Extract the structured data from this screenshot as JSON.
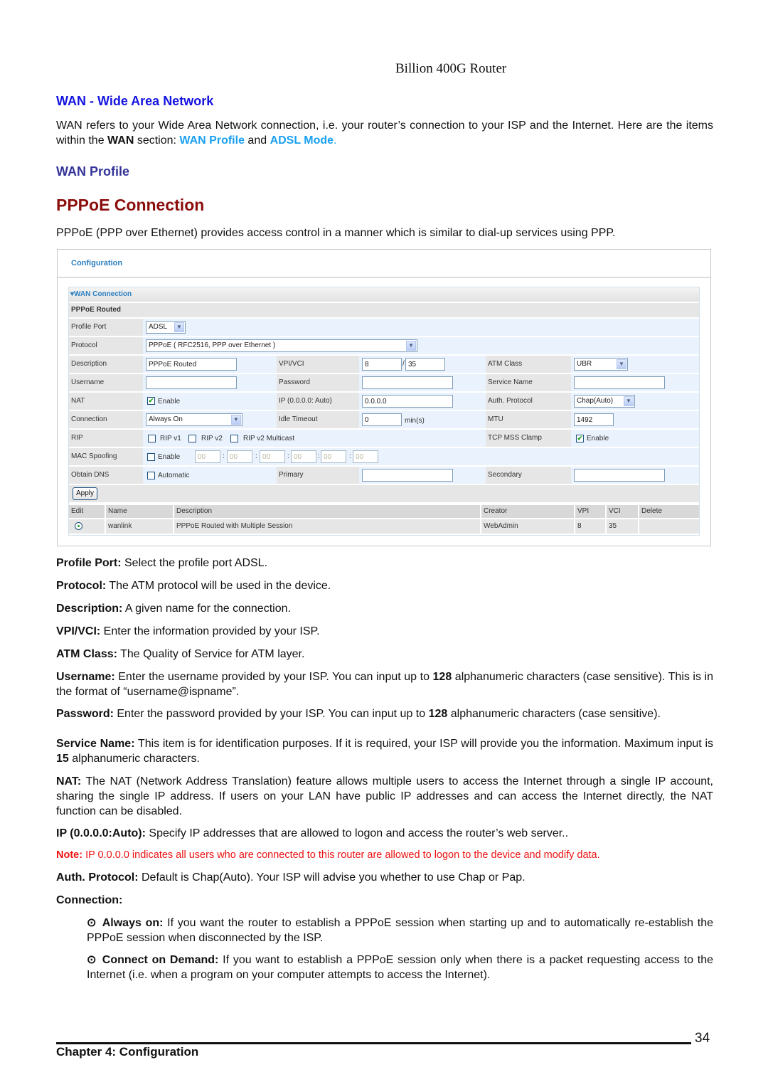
{
  "header": {
    "title": "Billion 400G Router"
  },
  "section": {
    "heading": "WAN - Wide Area Network",
    "intro_part1": "WAN refers to your Wide Area Network connection, i.e. your router’s connection to your ISP and the Internet. Here are the items within the ",
    "intro_bold": "WAN",
    "intro_part2": " section: ",
    "link_wan_profile": "WAN Profile",
    "intro_and": " and ",
    "link_adsl_mode": "ADSL Mode",
    "intro_end": "."
  },
  "subheading": "WAN Profile",
  "pppoe": {
    "heading": "PPPoE Connection",
    "description": "PPPoE (PPP over Ethernet) provides access control in a manner which is similar to dial-up services using PPP."
  },
  "config_ui": {
    "title": "Configuration",
    "section_label": "WAN Connection",
    "section_arrow": "▾",
    "subsection": "PPPoE Routed",
    "fields": {
      "profile_port": {
        "label": "Profile Port",
        "value": "ADSL"
      },
      "protocol": {
        "label": "Protocol",
        "value": "PPPoE ( RFC2516, PPP over Ethernet )"
      },
      "description": {
        "label": "Description",
        "value": "PPPoE Routed"
      },
      "vpi_vci": {
        "label": "VPI/VCI",
        "vpi": "8",
        "separator": "/",
        "vci": "35"
      },
      "atm_class": {
        "label": "ATM Class",
        "value": "UBR"
      },
      "username": {
        "label": "Username",
        "value": ""
      },
      "password": {
        "label": "Password",
        "value": ""
      },
      "service_name": {
        "label": "Service Name",
        "value": ""
      },
      "nat": {
        "label": "NAT",
        "checkbox_label": "Enable",
        "checked": true
      },
      "ip": {
        "label": "IP (0.0.0.0: Auto)",
        "value": "0.0.0.0"
      },
      "auth_protocol": {
        "label": "Auth. Protocol",
        "value": "Chap(Auto)"
      },
      "connection": {
        "label": "Connection",
        "value": "Always On"
      },
      "idle_timeout": {
        "label": "Idle Timeout",
        "value": "0",
        "unit": "min(s)"
      },
      "mtu": {
        "label": "MTU",
        "value": "1492"
      },
      "rip": {
        "label": "RIP",
        "options": [
          {
            "label": "RIP v1",
            "checked": false
          },
          {
            "label": "RIP v2",
            "checked": false
          },
          {
            "label": "RIP v2 Multicast",
            "checked": false
          }
        ]
      },
      "tcp_mss": {
        "label": "TCP MSS Clamp",
        "checkbox_label": "Enable",
        "checked": true
      },
      "mac_spoofing": {
        "label": "MAC Spoofing",
        "checkbox_label": "Enable",
        "checked": false,
        "octets": [
          "00",
          "00",
          "00",
          "00",
          "00",
          "00"
        ],
        "separator": ":"
      },
      "obtain_dns": {
        "label": "Obtain DNS",
        "checkbox_label": "Automatic",
        "checked": false
      },
      "primary": {
        "label": "Primary",
        "value": ""
      },
      "secondary": {
        "label": "Secondary",
        "value": ""
      }
    },
    "apply_label": "Apply",
    "table": {
      "headers": [
        "Edit",
        "Name",
        "Description",
        "Creator",
        "VPI",
        "VCI",
        "Delete"
      ],
      "rows": [
        {
          "name": "wanlink",
          "description": "PPPoE Routed with Multiple Session",
          "creator": "WebAdmin",
          "vpi": "8",
          "vci": "35",
          "delete": ""
        }
      ]
    }
  },
  "descriptions": [
    {
      "term": "Profile Port:",
      "text": " Select the profile port ADSL."
    },
    {
      "term": "Protocol:",
      "text": " The ATM protocol will be used in the device."
    },
    {
      "term": "Description:",
      "text": " A given name for the connection."
    },
    {
      "term": "VPI/VCI:",
      "text": " Enter the information provided by your ISP."
    },
    {
      "term": "ATM Class:",
      "text": " The Quality of Service for ATM layer."
    }
  ],
  "username_desc": {
    "term": "Username:",
    "text1": " Enter the username provided by your ISP. You can input up to ",
    "num": "128",
    "text2": " alphanumeric characters (case sensitive). This is in the format of “username@ispname”."
  },
  "password_desc": {
    "term": "Password:",
    "text1": " Enter the password provided by your ISP. You can input up to ",
    "num": "128",
    "text2": " alphanumeric characters (case sensitive)."
  },
  "service_desc": {
    "term": "Service Name:",
    "text1": " This item is for identification purposes. If it is required, your ISP will provide you the information. Maximum input is ",
    "num": "15",
    "text2": " alphanumeric characters."
  },
  "nat_desc": {
    "term": "NAT:",
    "text": " The NAT (Network Address Translation) feature allows multiple users to access the Internet through a single IP account, sharing the single IP address. If users on your LAN have public IP addresses and can access the Internet directly, the NAT function can be disabled."
  },
  "ip_desc": {
    "term": "IP (0.0.0.0:Auto):",
    "text": " Specify IP addresses that are allowed to logon and access the router’s web server.."
  },
  "note": {
    "term": "Note:",
    "text": " IP 0.0.0.0 indicates all users who are connected to this router are allowed to logon to the device and modify data."
  },
  "auth_desc": {
    "term": "Auth. Protocol:",
    "text": " Default is Chap(Auto). Your ISP will advise you whether to use Chap or Pap."
  },
  "connection_desc": {
    "term": "Connection:",
    "bullet_icon": "⊙",
    "items": [
      {
        "term": "Always on:",
        "text": " If you want the router to establish a PPPoE session when starting up and to automatically re-establish the PPPoE session when disconnected by the ISP."
      },
      {
        "term": "Connect on Demand:",
        "text": " If you want to establish a PPPoE session only when there is a packet requesting access to the Internet (i.e. when a program on your computer attempts to access the Internet)."
      }
    ]
  },
  "footer": {
    "page_number": "34",
    "chapter": "Chapter 4: Configuration"
  },
  "colors": {
    "heading_blue": "#1414e0",
    "subheading_navy": "#333399",
    "link_blue": "#1aa0f0",
    "pppoe_red": "#8b0d0d",
    "note_red": "#ee1111",
    "config_blue": "#2a7fc0"
  }
}
